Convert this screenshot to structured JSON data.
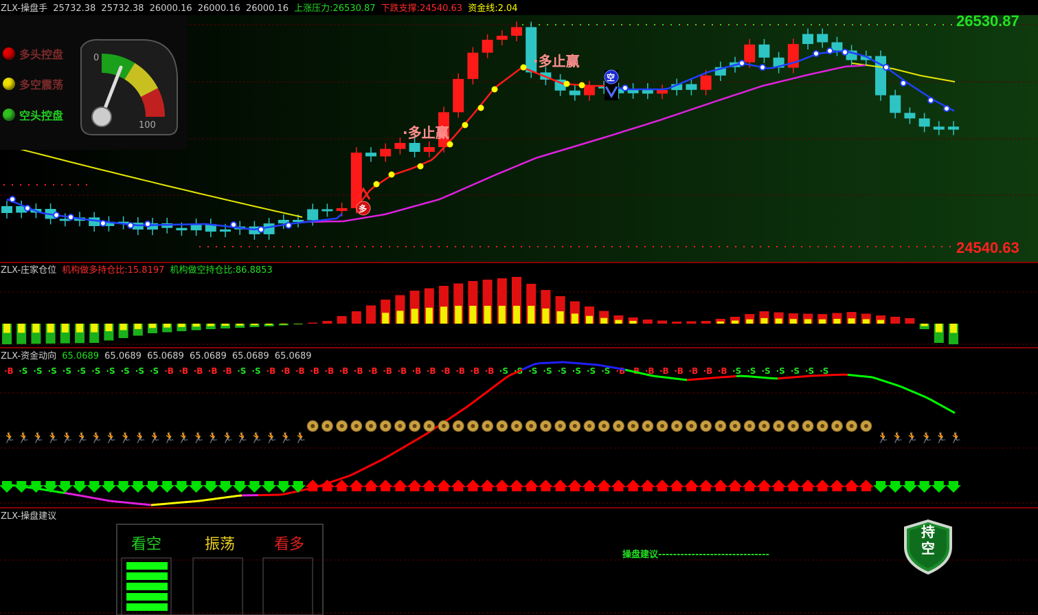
{
  "main_panel": {
    "indicator_name": "ZLX-操盘手",
    "ohlc_values": [
      "25732.38",
      "25732.38",
      "26000.16",
      "26000.16",
      "26000.16"
    ],
    "resistance_label": "上涨压力:26530.87",
    "support_label": "下跌支撑:24540.63",
    "fund_line_label": "资金线:2.04",
    "resistance_value": "26530.87",
    "support_value": "24540.63",
    "legend": [
      {
        "label": "多头控盘",
        "color": "#e00000"
      },
      {
        "label": "多空震荡",
        "color": "#f0e000"
      },
      {
        "label": "空头控盘",
        "color": "#30c020"
      }
    ],
    "gauge": {
      "min_label": "0",
      "max_label": "100"
    },
    "signal_labels": {
      "long_win": "多止赢",
      "long_win_2": "多止赢",
      "long_badge": "多",
      "short_badge": "空"
    }
  },
  "position_panel": {
    "indicator_name": "ZLX-庄家仓位",
    "long_ratio_label": "机构做多持仓比:15.8197",
    "short_ratio_label": "机构做空持仓比:86.8853"
  },
  "fund_panel": {
    "indicator_name": "ZLX-资金动向",
    "values": [
      "65.0689",
      "65.0689",
      "65.0689",
      "65.0689",
      "65.0689",
      "65.0689"
    ],
    "bs_markers": "BSSSSSSSSSSBBBBBSSBBBBBBBBBBBBBBBBSSSSSSSSBBBBBBBBSSSSSSS"
  },
  "advice_panel": {
    "indicator_name": "ZLX-操盘建议",
    "columns": [
      "看空",
      "振荡",
      "看多"
    ],
    "advice_label": "操盘建议------------------------------",
    "badge_text": "持空",
    "bearish_level_bars": 5
  },
  "colors": {
    "bull": "#ff1a1a",
    "bear": "#2ec4c4",
    "fund_up": "#ff0000",
    "fund_down": "#00ff00",
    "accent_green": "#22e022"
  }
}
